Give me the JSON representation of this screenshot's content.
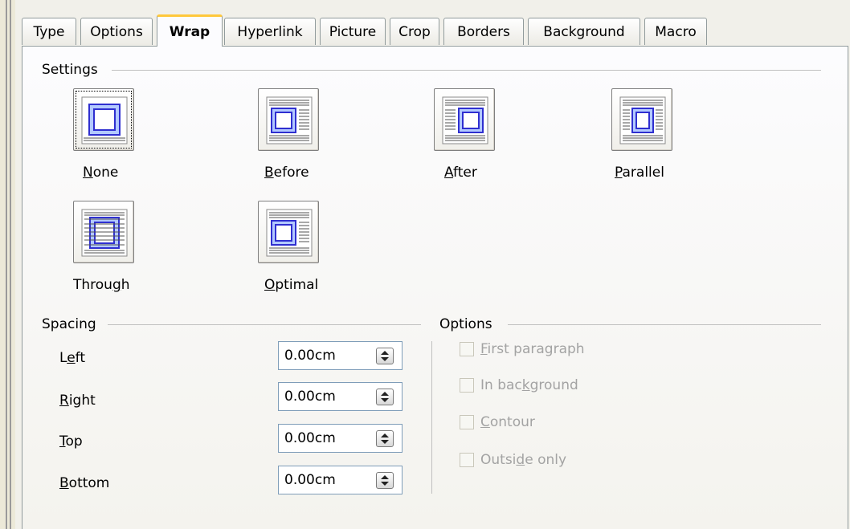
{
  "tabs": [
    "Type",
    "Options",
    "Wrap",
    "Hyperlink",
    "Picture",
    "Crop",
    "Borders",
    "Background",
    "Macro"
  ],
  "active_tab": "Wrap",
  "settings": {
    "title": "Settings",
    "options": [
      {
        "pre": "",
        "ul": "N",
        "post": "one",
        "icon": "wrap-none-icon",
        "selected": true
      },
      {
        "pre": "",
        "ul": "B",
        "post": "efore",
        "icon": "wrap-before-icon",
        "selected": false
      },
      {
        "pre": "",
        "ul": "A",
        "post": "fter",
        "icon": "wrap-after-icon",
        "selected": false
      },
      {
        "pre": "",
        "ul": "P",
        "post": "arallel",
        "icon": "wrap-parallel-icon",
        "selected": false
      },
      {
        "pre": "Throu",
        "ul": "g",
        "post": "h",
        "icon": "wrap-through-icon",
        "selected": false
      },
      {
        "pre": "",
        "ul": "O",
        "post": "ptimal",
        "icon": "wrap-optimal-icon",
        "selected": false
      }
    ]
  },
  "spacing": {
    "title": "Spacing",
    "fields": [
      {
        "pre": "L",
        "ul": "e",
        "post": "ft",
        "value": "0.00cm"
      },
      {
        "pre": "",
        "ul": "R",
        "post": "ight",
        "value": "0.00cm"
      },
      {
        "pre": "",
        "ul": "T",
        "post": "op",
        "value": "0.00cm"
      },
      {
        "pre": "",
        "ul": "B",
        "post": "ottom",
        "value": "0.00cm"
      }
    ]
  },
  "options_group": {
    "title": "Options",
    "checkboxes": [
      {
        "pre": "",
        "ul": "F",
        "post": "irst paragraph",
        "checked": false,
        "enabled": false
      },
      {
        "pre": "In bac",
        "ul": "k",
        "post": "ground",
        "checked": false,
        "enabled": false
      },
      {
        "pre": "",
        "ul": "C",
        "post": "ontour",
        "checked": false,
        "enabled": false
      },
      {
        "pre": "Outsi",
        "ul": "d",
        "post": "e only",
        "checked": false,
        "enabled": false
      }
    ]
  },
  "colors": {
    "icon_frame": "#2f2fd0",
    "icon_fill": "#b3c9ff",
    "text_lines": "#505050",
    "tab_highlight": "#ffc83c",
    "disabled_text": "#a3a3a3"
  }
}
